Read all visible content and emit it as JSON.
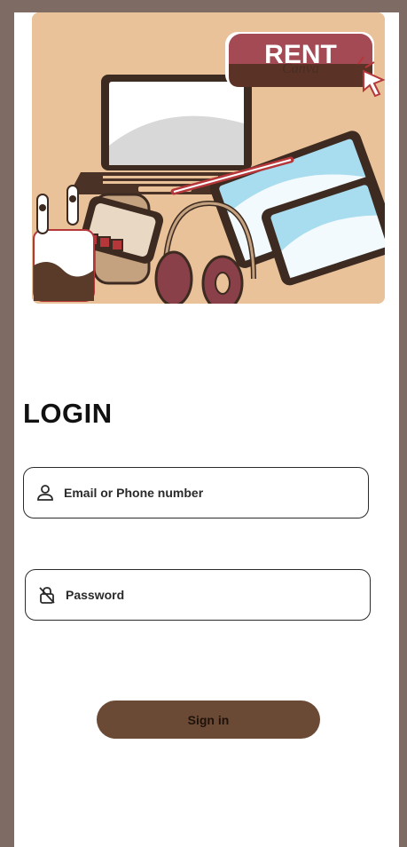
{
  "hero": {
    "badge_text": "RENT",
    "watermark": "Canva",
    "icon": "devices-illustration"
  },
  "login": {
    "title": "LOGIN",
    "email_placeholder": "Email or Phone number",
    "email_icon": "user-icon",
    "password_placeholder": "Password",
    "password_icon": "lock-off-icon",
    "signin_label": "Sign in"
  },
  "colors": {
    "background": "#7d6b64",
    "hero_bg": "#e9c29a",
    "button": "#6b4a35",
    "accent_red": "#b5373a"
  }
}
